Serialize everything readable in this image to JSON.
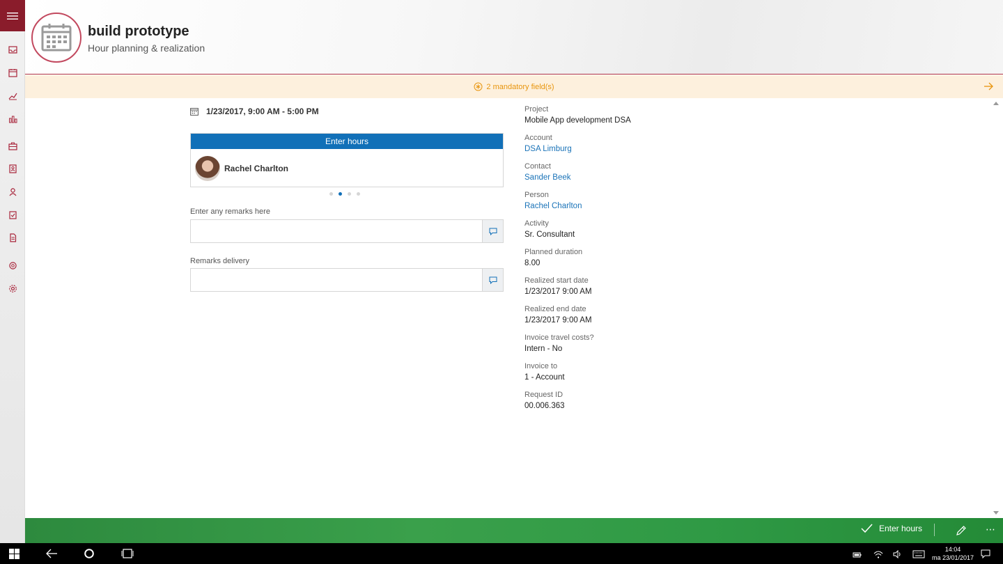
{
  "header": {
    "title": "build prototype",
    "subtitle": "Hour planning & realization",
    "icon": "calendar-icon"
  },
  "mandatory": {
    "text": "2 mandatory field(s)",
    "color": "#e8950d"
  },
  "planning": {
    "date_range": "1/23/2017, 9:00 AM - 5:00 PM",
    "card_header": "Enter hours",
    "person_name": "Rachel Charlton",
    "page_dots": 4,
    "active_dot": 2
  },
  "remarks": {
    "label": "Enter any remarks here",
    "value": ""
  },
  "remarks_delivery": {
    "label": "Remarks delivery",
    "value": ""
  },
  "details": [
    {
      "label": "Project",
      "value": "Mobile App development DSA",
      "link": false
    },
    {
      "label": "Account",
      "value": "DSA Limburg",
      "link": true
    },
    {
      "label": "Contact",
      "value": "Sander Beek",
      "link": true
    },
    {
      "label": "Person",
      "value": "Rachel Charlton",
      "link": true
    },
    {
      "label": "Activity",
      "value": "Sr. Consultant",
      "link": false
    },
    {
      "label": "Planned duration",
      "value": "8.00",
      "link": false
    },
    {
      "label": "Realized start date",
      "value": "1/23/2017 9:00 AM",
      "link": false
    },
    {
      "label": "Realized end date",
      "value": "1/23/2017 9:00 AM",
      "link": false
    },
    {
      "label": "Invoice travel costs?",
      "value": "Intern - No",
      "link": false
    },
    {
      "label": "Invoice to",
      "value": "1 - Account",
      "link": false
    },
    {
      "label": "Request ID",
      "value": "00.006.363",
      "link": false
    }
  ],
  "command_bar": {
    "enter_hours_label": "Enter hours",
    "more_label": "⋯"
  },
  "taskbar": {
    "time": "14:04",
    "date": "ma 23/01/2017"
  },
  "colors": {
    "brand": "#8a1c2b",
    "accent_blue": "#1170b8",
    "command_green": "#2f9a45",
    "warning_bg": "#fdf0dd"
  }
}
